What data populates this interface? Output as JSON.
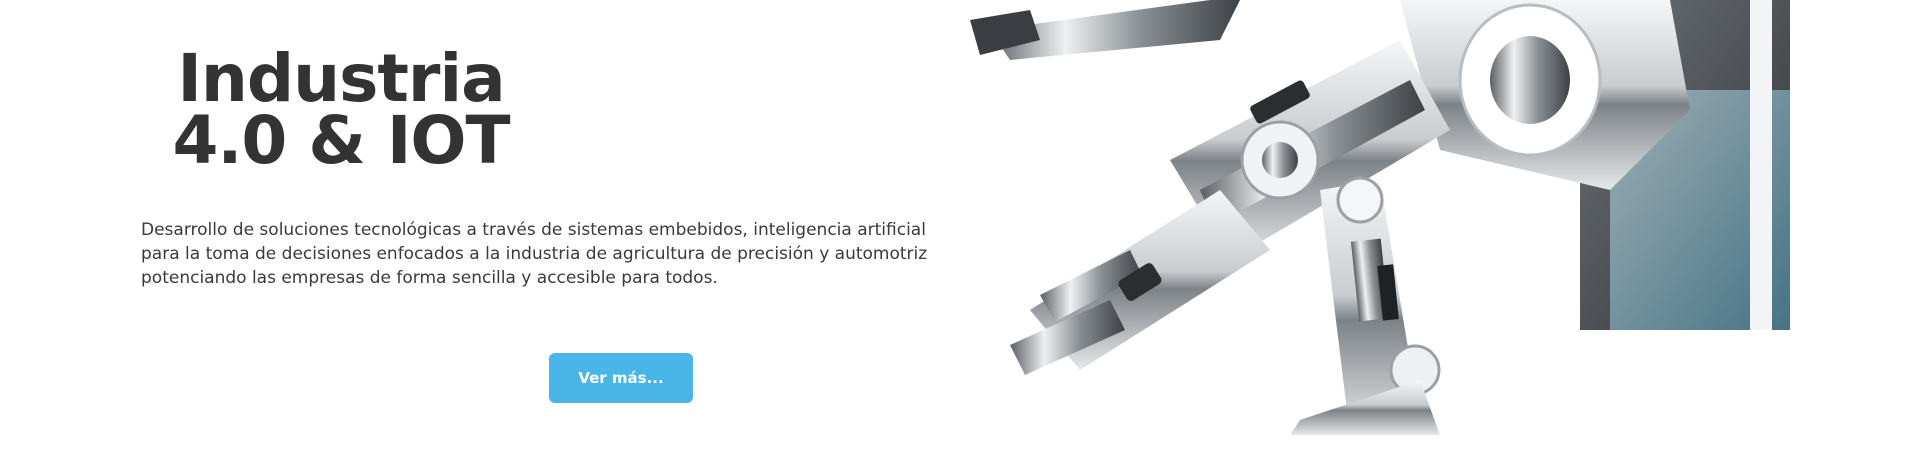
{
  "hero": {
    "title_line1": "Industria",
    "title_line2": "4.0 & IOT",
    "description": "Desarrollo de soluciones tecnológicas a través de sistemas embebidos, inteligencia artificial para la toma de decisiones enfocados a la industria de agricultura de precisión y automotriz potenciando las empresas de forma sencilla y accesible para todos.",
    "cta_label": "Ver más...",
    "image": "robotic-arm-illustration"
  },
  "colors": {
    "title": "#333333",
    "text": "#3a3a3a",
    "accent": "#4ab6e8",
    "background": "#ffffff"
  }
}
